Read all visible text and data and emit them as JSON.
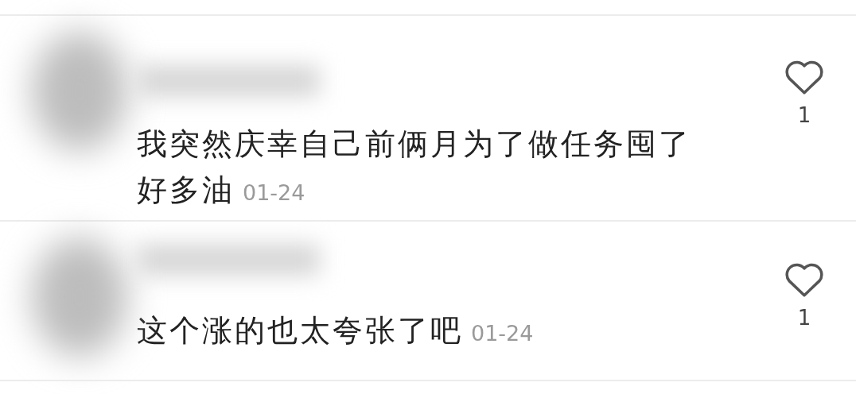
{
  "comments": [
    {
      "text": "我突然庆幸自己前俩月为了做任务囤了好多油",
      "date": "01-24",
      "likes": "1",
      "liked": false
    },
    {
      "text": "这个涨的也太夸张了吧",
      "date": "01-24",
      "likes": "1",
      "liked": false
    }
  ]
}
